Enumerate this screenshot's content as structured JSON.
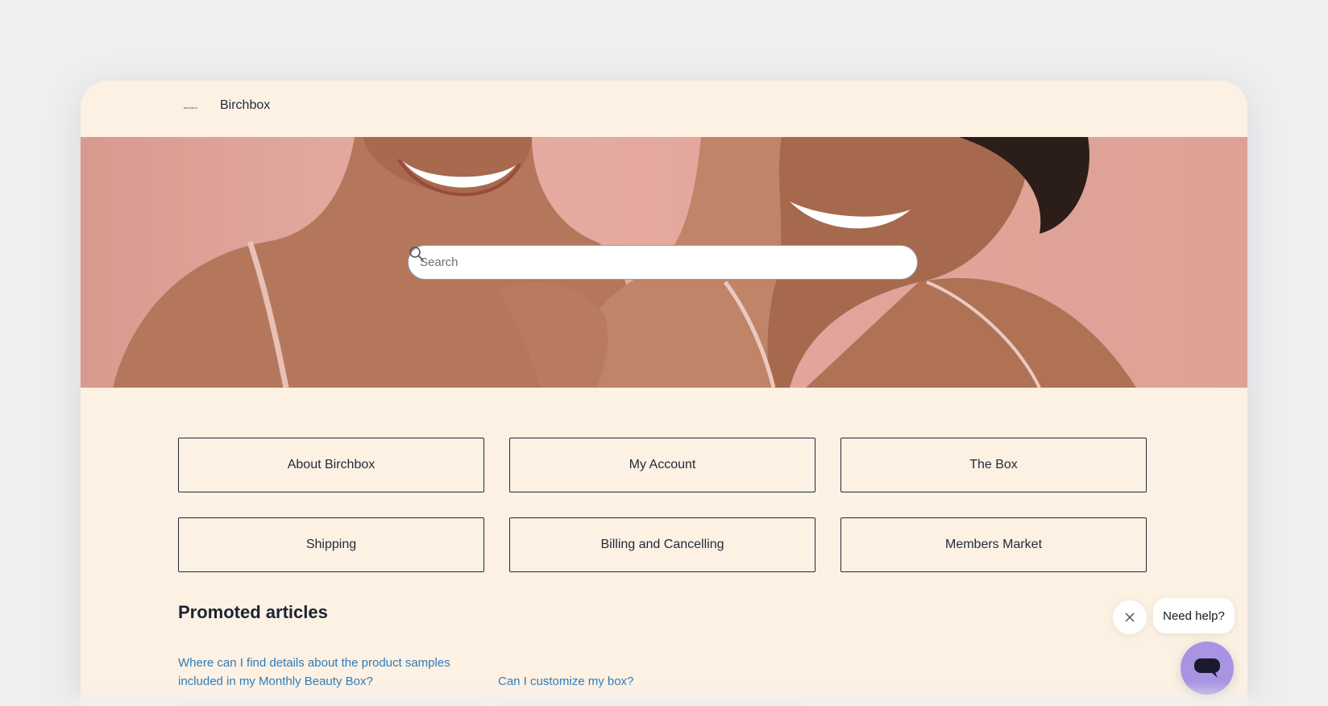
{
  "header": {
    "logo_text": "BIRCHBOX",
    "brand_name": "Birchbox"
  },
  "search": {
    "placeholder": "Search",
    "value": ""
  },
  "categories": [
    {
      "label": "About Birchbox"
    },
    {
      "label": "My Account"
    },
    {
      "label": "The Box"
    },
    {
      "label": "Shipping"
    },
    {
      "label": "Billing and Cancelling"
    },
    {
      "label": "Members Market"
    }
  ],
  "promoted": {
    "title": "Promoted articles",
    "articles": [
      {
        "title": "Where can I find details about the product samples included in my Monthly Beauty Box?"
      },
      {
        "title": "Can I customize my box?"
      }
    ]
  },
  "chat": {
    "bubble_text": "Need help?",
    "launcher_color": "#a894e2"
  },
  "colors": {
    "page_bg": "#fdf1e4",
    "link": "#2b7bb9",
    "text": "#1f2a3a",
    "hero_bg": "#e2a59b"
  }
}
